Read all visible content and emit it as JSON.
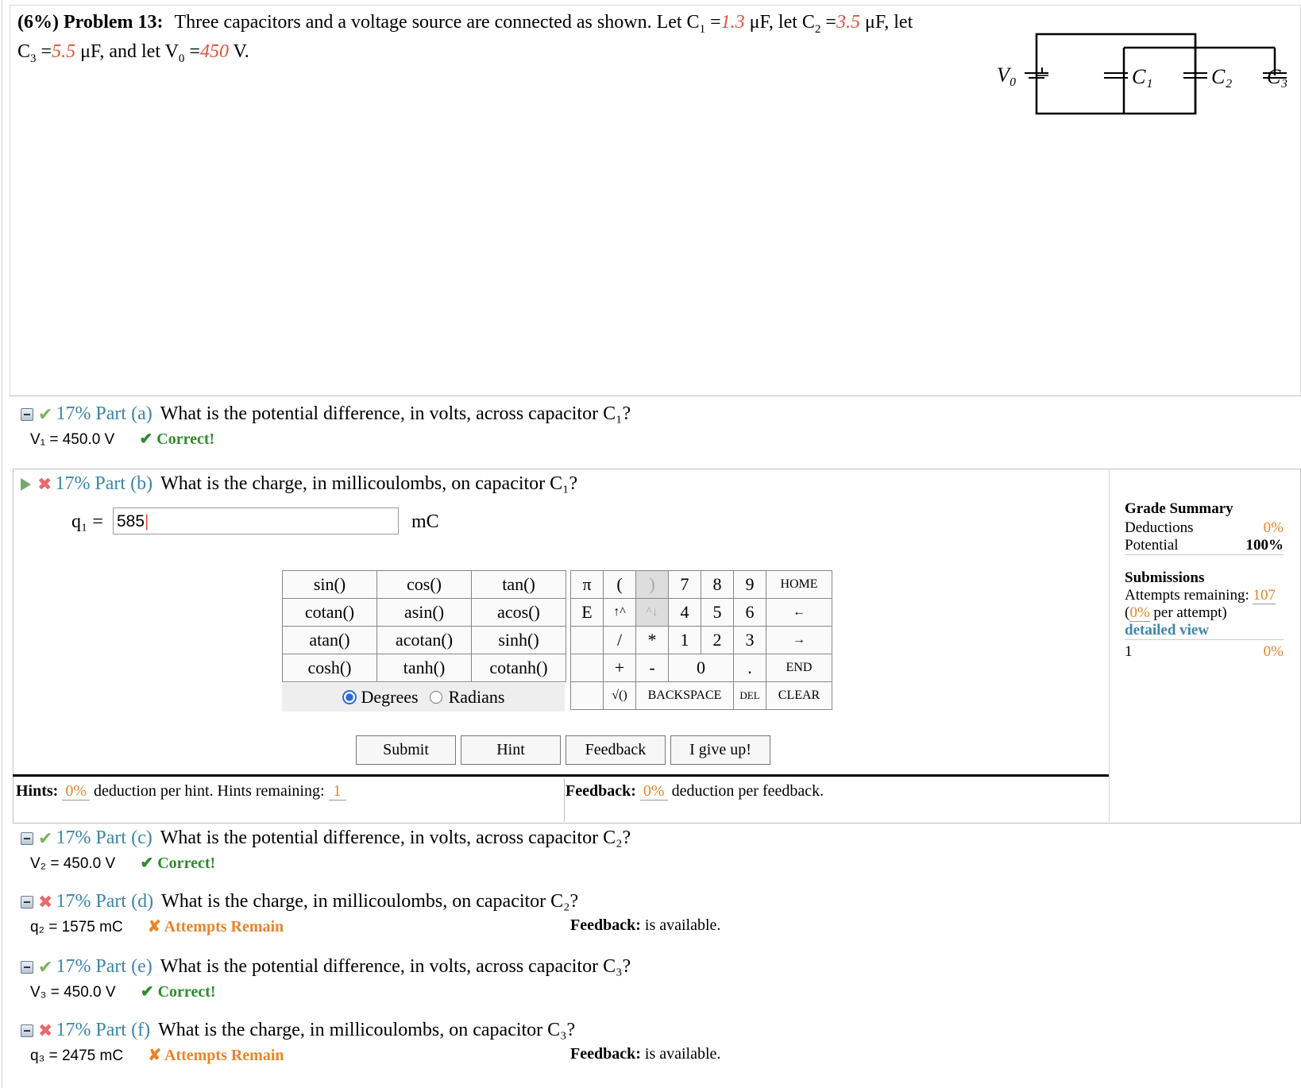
{
  "problem": {
    "header": "(6%) Problem 13:",
    "text_1": "Three capacitors and a voltage source are connected as shown. Let C",
    "c1_val": "1.3",
    "text_2": "μF, let C",
    "c2_val": "3.5",
    "text_3": "μF, let",
    "text_4": "C",
    "c3_val": "5.5",
    "text_5": "μF, and let V",
    "v0_val": "450",
    "text_6": "V."
  },
  "diagram": {
    "v0": "V₀",
    "c1": "C₁",
    "c2": "C₂",
    "c3": "C₃"
  },
  "parts": {
    "a": {
      "title": "17% Part (a)",
      "question": "What is the potential difference, in volts, across capacitor C₁?",
      "answer": "V₁ = 450.0 V",
      "status": "✔ Correct!"
    },
    "b": {
      "title": "17% Part (b)",
      "question": "What is the charge, in millicoulombs, on capacitor C₁?",
      "label": "q₁ =",
      "input_value": "585",
      "unit": "mC"
    },
    "c": {
      "title": "17% Part (c)",
      "question": "What is the potential difference, in volts, across capacitor C₂?",
      "answer": "V₂ = 450.0 V",
      "status": "✔ Correct!"
    },
    "d": {
      "title": "17% Part (d)",
      "question": "What is the charge, in millicoulombs, on capacitor C₂?",
      "answer": "q₂ = 1575 mC",
      "status": "✘ Attempts Remain",
      "feedback_label": "Feedback:",
      "feedback_text": "is available."
    },
    "e": {
      "title": "17% Part (e)",
      "question": "What is the potential difference, in volts, across capacitor C₃?",
      "answer": "V₃ = 450.0 V",
      "status": "✔ Correct!"
    },
    "f": {
      "title": "17% Part (f)",
      "question": "What is the charge, in millicoulombs, on capacitor C₃?",
      "answer": "q₃ = 2475 mC",
      "status": "✘ Attempts Remain",
      "feedback_label": "Feedback:",
      "feedback_text": "is available."
    }
  },
  "calculator": {
    "functions": [
      [
        "sin()",
        "cos()",
        "tan()"
      ],
      [
        "cotan()",
        "asin()",
        "acos()"
      ],
      [
        "atan()",
        "acotan()",
        "sinh()"
      ],
      [
        "cosh()",
        "tanh()",
        "cotanh()"
      ]
    ],
    "keypad": {
      "r1": [
        "π",
        "(",
        ")",
        "7",
        "8",
        "9",
        "HOME"
      ],
      "r2": [
        "E",
        "↑^",
        "^↓",
        "4",
        "5",
        "6",
        "←"
      ],
      "r3": [
        "",
        "/",
        "*",
        "1",
        "2",
        "3",
        "→"
      ],
      "r4": [
        "",
        "+",
        "-",
        "0",
        ".",
        "END"
      ],
      "r5": [
        "",
        "√()",
        "BACKSPACE",
        "DEL",
        "CLEAR"
      ]
    },
    "degrees": "Degrees",
    "radians": "Radians"
  },
  "buttons": {
    "submit": "Submit",
    "hint": "Hint",
    "feedback": "Feedback",
    "give_up": "I give up!"
  },
  "hints": {
    "label": "Hints:",
    "pct": "0%",
    "text": "deduction per hint. Hints remaining:",
    "remaining": "1"
  },
  "feedback_bar": {
    "label": "Feedback:",
    "pct": "0%",
    "text": "deduction per feedback."
  },
  "grade_summary": {
    "title": "Grade Summary",
    "deductions_label": "Deductions",
    "deductions": "0%",
    "potential_label": "Potential",
    "potential": "100%",
    "submissions_title": "Submissions",
    "attempts_label": "Attempts remaining:",
    "attempts": "107",
    "per_attempt_pct": "0%",
    "per_attempt_text": "per attempt)",
    "detailed_view": "detailed view",
    "row_num": "1",
    "row_pct": "0%"
  }
}
